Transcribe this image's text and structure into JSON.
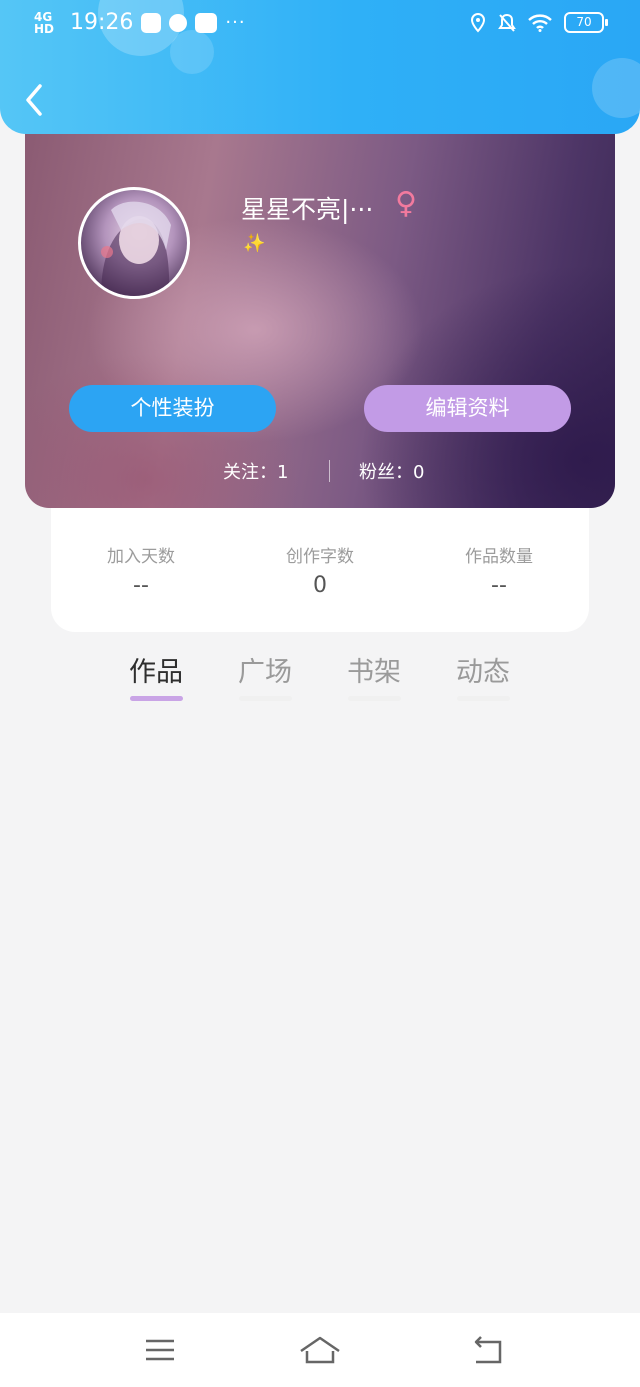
{
  "status_bar": {
    "signal": "4G HD",
    "time": "19:26",
    "more": "···",
    "battery": "70"
  },
  "profile": {
    "nickname": "星星不亮|···",
    "gender_symbol": "♀",
    "signature_icon": "✨",
    "dress_up_label": "个性装扮",
    "edit_profile_label": "编辑资料",
    "following": "关注：1",
    "fans": "粉丝：0"
  },
  "stats": [
    {
      "label": "加入天数",
      "value": "--"
    },
    {
      "label": "创作字数",
      "value": "0"
    },
    {
      "label": "作品数量",
      "value": "--"
    }
  ],
  "tabs": [
    {
      "label": "作品",
      "active": true
    },
    {
      "label": "广场",
      "active": false
    },
    {
      "label": "书架",
      "active": false
    },
    {
      "label": "动态",
      "active": false
    }
  ],
  "nav": {
    "menu_icon": "menu-icon",
    "home_icon": "home-icon",
    "back_icon": "return-icon"
  },
  "colors": {
    "header": "#2fb0f7",
    "dress_button": "#2ca4f3",
    "edit_button": "#c29be6",
    "tab_indicator": "#c9a4e6",
    "gender": "#f27a9e"
  }
}
